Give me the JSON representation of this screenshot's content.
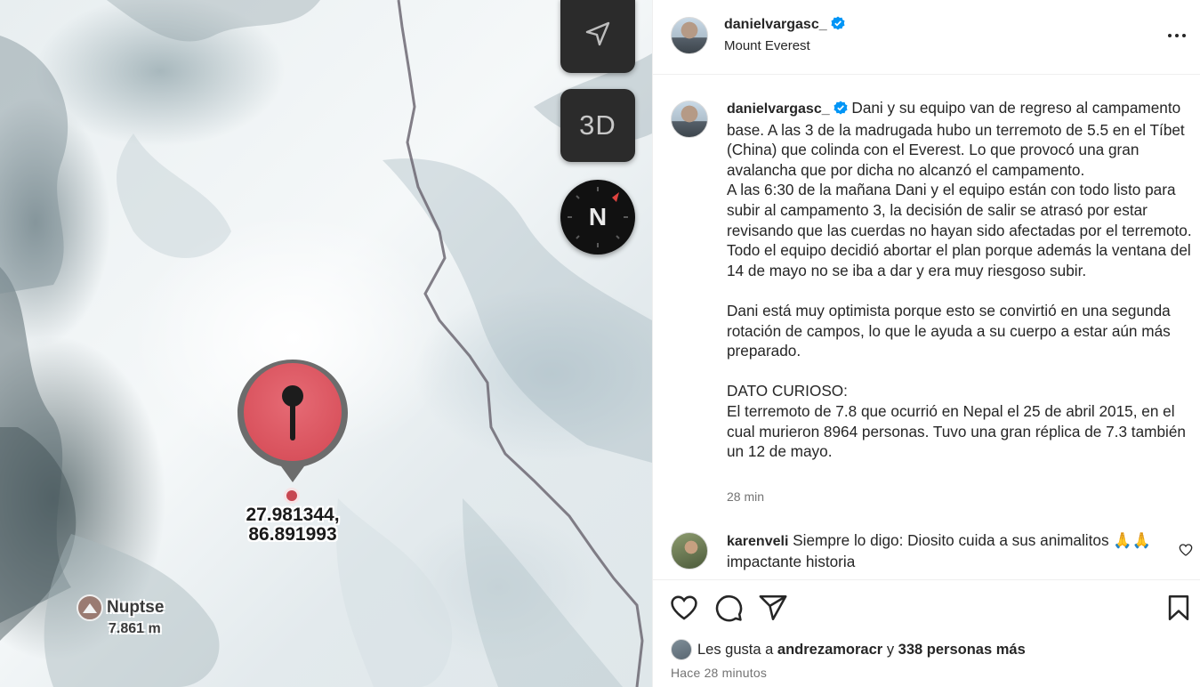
{
  "map": {
    "btn_3d_label": "3D",
    "compass_label": "N",
    "pin_coords_line1": "27.981344,",
    "pin_coords_line2": "86.891993",
    "peak_name": "Nuptse",
    "peak_elevation": "7.861 m",
    "icons": [
      "navigation-arrow-icon",
      "compass-icon",
      "map-pin-icon",
      "mountain-peak-icon"
    ]
  },
  "post": {
    "author": "danielvargasc_",
    "location": "Mount Everest",
    "caption": "Dani y su equipo van de regreso al campamento base. A las 3 de la madrugada hubo un terremoto de 5.5 en el Tíbet (China) que colinda con el Everest. Lo que provocó una gran avalancha que por dicha no alcanzó el campamento.\nA las 6:30 de la mañana Dani y el equipo están con todo listo para subir al campamento 3, la decisión de salir se atrasó por estar revisando que las cuerdas no hayan sido afectadas por el terremoto.\nTodo el equipo decidió abortar el plan porque además la ventana del 14 de mayo no se iba a dar y era muy riesgoso subir.\n\nDani está muy optimista porque esto se convirtió en una segunda rotación de campos, lo que le ayuda a su cuerpo a estar aún más preparado.\n\nDATO CURIOSO:\nEl terremoto de 7.8 que ocurrió en Nepal el 25 de abril 2015, en el cual murieron 8964 personas. Tuvo una gran réplica de 7.3 también un 12 de mayo.",
    "caption_time": "28 min",
    "verified_color": "#0095f6"
  },
  "comments": [
    {
      "user": "karenveli",
      "text": "Siempre lo digo: Diosito cuida a sus animalitos 🙏🙏 impactante historia"
    }
  ],
  "likes": {
    "prefix": "Les gusta a",
    "user": "andrezamoracr",
    "joiner": "y",
    "others": "338 personas más"
  },
  "posted_ago": "Hace 28 minutos"
}
